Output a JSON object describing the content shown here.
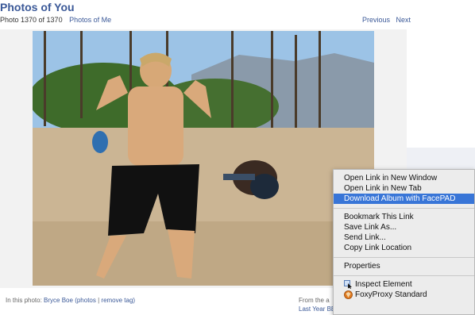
{
  "header": {
    "title": "Photos of You",
    "photo_count": "Photo 1370 of 1370",
    "photos_of_me_link": "Photos of Me",
    "previous_label": "Previous",
    "next_label": "Next"
  },
  "caption": {
    "prefix": "In this photo:",
    "person_name": "Bryce Boe",
    "photos_link": "(photos",
    "separator": " | ",
    "remove_tag_link": "remove tag)"
  },
  "album": {
    "from_text": "From the a",
    "album_link": "Last Year BBQ pics by"
  },
  "context_menu": {
    "items": [
      {
        "label": "Open Link in New Window"
      },
      {
        "label": "Open Link in New Tab"
      },
      {
        "label": "Download Album with FacePAD",
        "highlighted": true
      }
    ],
    "group2": [
      {
        "label": "Bookmark This Link"
      },
      {
        "label": "Save Link As..."
      },
      {
        "label": "Send Link..."
      },
      {
        "label": "Copy Link Location"
      }
    ],
    "group3": [
      {
        "label": "Properties"
      }
    ],
    "group4": [
      {
        "label": "Inspect Element",
        "icon": "inspect-icon"
      },
      {
        "label": "FoxyProxy Standard",
        "icon": "foxyproxy-icon"
      }
    ]
  },
  "colors": {
    "link": "#3b5998",
    "menu_highlight": "#3875d7",
    "menu_bg": "#ececec"
  }
}
